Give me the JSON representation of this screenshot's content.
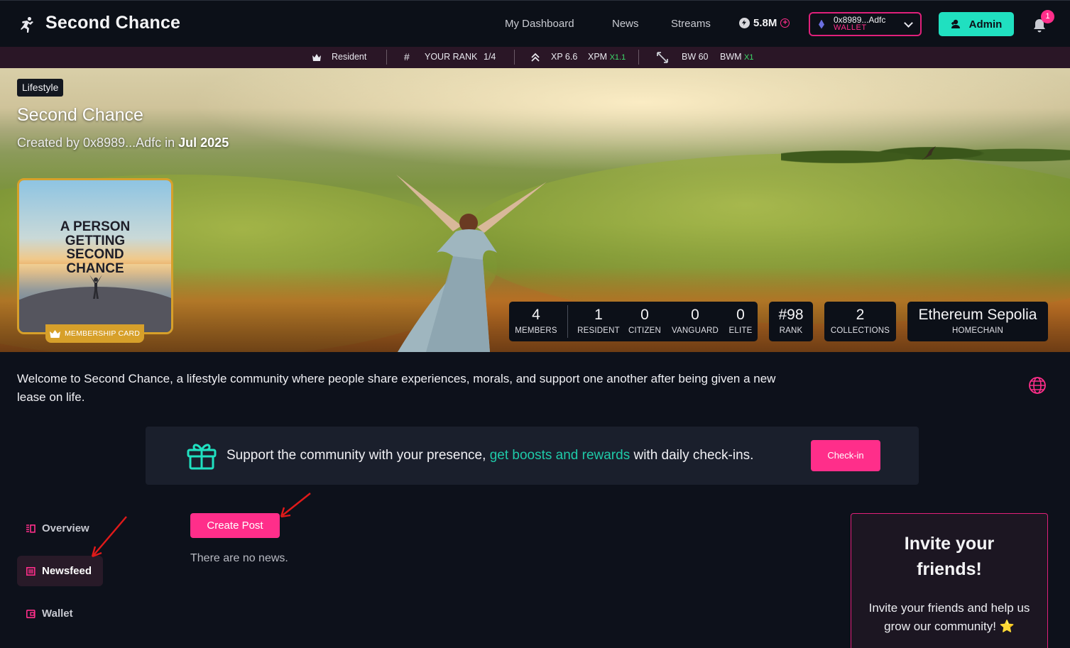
{
  "header": {
    "brand": "Second Chance",
    "nav": [
      "My Dashboard",
      "News",
      "Streams"
    ],
    "balance": "5.8M",
    "wallet_address": "0x8989...Adfc",
    "wallet_label": "WALLET",
    "admin_label": "Admin",
    "notification_count": "1"
  },
  "rankbar": {
    "role": "Resident",
    "rank_label": "YOUR RANK",
    "rank_value": "1/4",
    "xp": "XP 6.6",
    "xpm": "XPM",
    "xpm_mult": "X1.1",
    "bw": "BW 60",
    "bwm": "BWM",
    "bwm_mult": "X1"
  },
  "banner": {
    "tag": "Lifestyle",
    "title": "Second Chance",
    "created_prefix": "Created by 0x8989...Adfc in",
    "created_date": "Jul 2025",
    "card_lines": [
      "A PERSON",
      "GETTING",
      "SECOND",
      "CHANCE"
    ],
    "card_badge": "MEMBERSHIP CARD",
    "stats": {
      "members": {
        "num": "4",
        "lbl": "MEMBERS"
      },
      "resident": {
        "num": "1",
        "lbl": "RESIDENT"
      },
      "citizen": {
        "num": "0",
        "lbl": "CITIZEN"
      },
      "vanguard": {
        "num": "0",
        "lbl": "VANGUARD"
      },
      "elite": {
        "num": "0",
        "lbl": "ELITE"
      },
      "rank": {
        "num": "#98",
        "lbl": "RANK"
      },
      "collections": {
        "num": "2",
        "lbl": "COLLECTIONS"
      },
      "homechain": {
        "num": "Ethereum Sepolia",
        "lbl": "HOMECHAIN"
      }
    }
  },
  "description": "Welcome to Second Chance, a lifestyle community where people share experiences, morals, and support one another after being given a new lease on life.",
  "checkin": {
    "text_before": "Support the community with your presence, ",
    "text_link": "get boosts and rewards",
    "text_after": " with daily check-ins.",
    "button": "Check-in"
  },
  "sidebar": {
    "items": [
      {
        "label": "Overview"
      },
      {
        "label": "Newsfeed"
      },
      {
        "label": "Wallet"
      }
    ]
  },
  "feed": {
    "create_post": "Create Post",
    "empty": "There are no news."
  },
  "invite": {
    "title_line1": "Invite your",
    "title_line2": "friends!",
    "body": "Invite your friends and help us grow our community! ⭐"
  },
  "colors": {
    "accent_pink": "#ff2e8a",
    "accent_teal": "#20e0c0",
    "gold": "#d7a02a",
    "background": "#0d111b"
  }
}
